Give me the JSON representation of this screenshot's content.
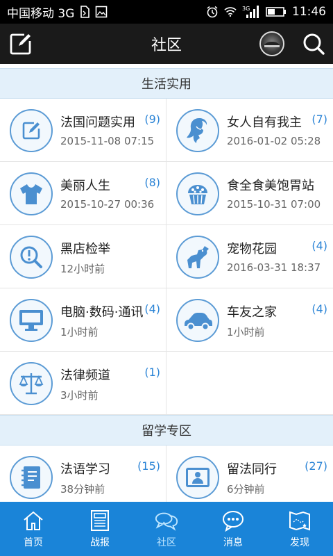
{
  "status_bar": {
    "carrier": "中国移动 3G",
    "time": "11:46",
    "signal_label": "3G"
  },
  "header": {
    "title": "社区"
  },
  "sections": [
    {
      "title": "生活实用",
      "items": [
        {
          "name": "法国问题实用",
          "time": "2015-11-08 07:15",
          "count": "(9)",
          "icon": "edit-icon"
        },
        {
          "name": "女人自有我主",
          "time": "2016-01-02 05:28",
          "count": "(7)",
          "icon": "woman-icon"
        },
        {
          "name": "美丽人生",
          "time": "2015-10-27 00:36",
          "count": "(8)",
          "icon": "tshirt-icon"
        },
        {
          "name": "食全食美饱胃站",
          "time": "2015-10-31 07:00",
          "count": "",
          "icon": "cupcake-icon"
        },
        {
          "name": "黑店检举",
          "time": "12小时前",
          "count": "",
          "icon": "magnifier-alert-icon"
        },
        {
          "name": "宠物花园",
          "time": "2016-03-31 18:37",
          "count": "(4)",
          "icon": "dog-icon"
        },
        {
          "name": "电脑·数码·通讯",
          "time": "1小时前",
          "count": "(4)",
          "icon": "monitor-icon"
        },
        {
          "name": "车友之家",
          "time": "1小时前",
          "count": "(4)",
          "icon": "car-icon"
        },
        {
          "name": "法律频道",
          "time": "3小时前",
          "count": "(1)",
          "icon": "scales-icon"
        }
      ]
    },
    {
      "title": "留学专区",
      "items": [
        {
          "name": "法语学习",
          "time": "38分钟前",
          "count": "(15)",
          "icon": "notebook-icon"
        },
        {
          "name": "留法同行",
          "time": "6分钟前",
          "count": "(27)",
          "icon": "id-card-icon"
        }
      ]
    }
  ],
  "tabs": [
    {
      "label": "首页",
      "icon": "home-icon",
      "active": false
    },
    {
      "label": "战报",
      "icon": "newspaper-icon",
      "active": false
    },
    {
      "label": "社区",
      "icon": "chat-bubbles-icon",
      "active": true
    },
    {
      "label": "消息",
      "icon": "message-icon",
      "active": false
    },
    {
      "label": "发现",
      "icon": "map-icon",
      "active": false
    }
  ],
  "colors": {
    "accent": "#1a84d8",
    "section_bg": "#e3f0fa",
    "icon_stroke": "#5b9bd5",
    "count": "#2b84d6"
  }
}
